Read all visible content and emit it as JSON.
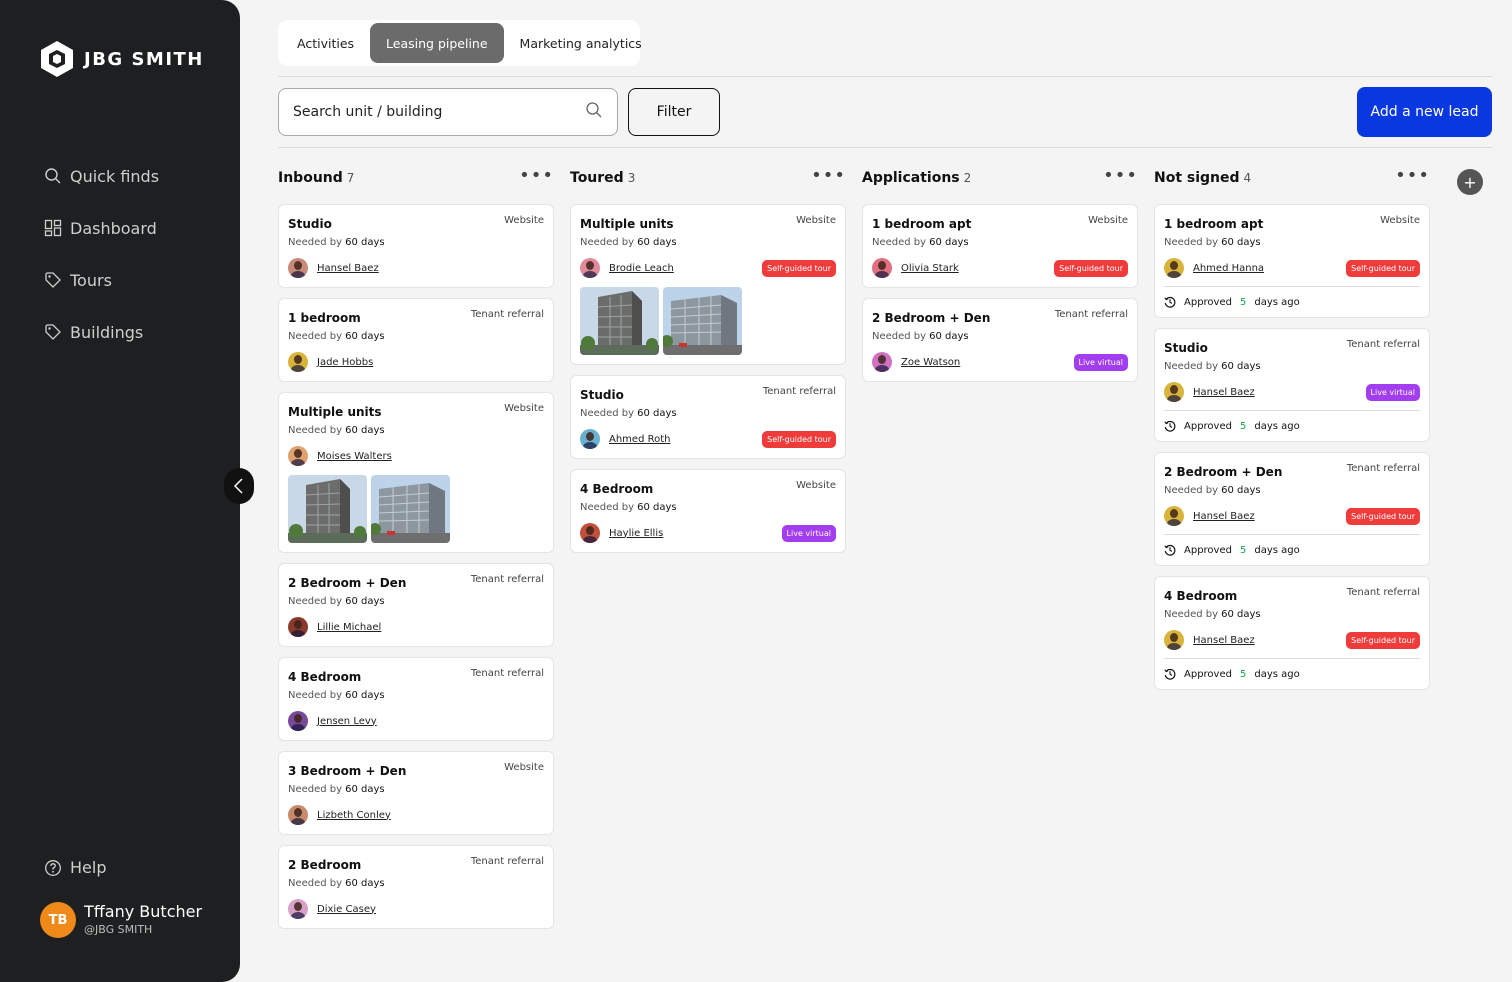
{
  "brand": {
    "name": "JBG SMITH"
  },
  "sidebar": {
    "nav": [
      {
        "label": "Quick finds",
        "icon": "search-icon"
      },
      {
        "label": "Dashboard",
        "icon": "dashboard-icon"
      },
      {
        "label": "Tours",
        "icon": "tag-icon"
      },
      {
        "label": "Buildings",
        "icon": "tag-icon"
      }
    ],
    "help": "Help",
    "user": {
      "initials": "TB",
      "name": "Tffany Butcher",
      "handle": "@JBG SMITH"
    }
  },
  "tabs": [
    {
      "label": "Activities",
      "active": false
    },
    {
      "label": "Leasing pipeline",
      "active": true
    },
    {
      "label": "Marketing analytics",
      "active": false
    }
  ],
  "toolbar": {
    "search_placeholder": "Search unit / building",
    "filter_label": "Filter",
    "add_label": "Add a new lead"
  },
  "colors": {
    "accent": "#0938e0",
    "tour_badge": "#f03b3b",
    "virtual_badge": "#a23ef0",
    "approved_count": "#1aa34a"
  },
  "columns": [
    {
      "title": "Inbound",
      "count": "7",
      "cards": [
        {
          "title": "Studio",
          "source": "Website",
          "needed_label": "Needed by",
          "needed_value": "60 days",
          "person": "Hansel Baez",
          "avatar": "#c98a7a"
        },
        {
          "title": "1 bedroom",
          "source": "Tenant referral",
          "needed_label": "Needed by",
          "needed_value": "60 days",
          "person": "Jade Hobbs",
          "avatar": "#d9b43a"
        },
        {
          "title": "Multiple units",
          "source": "Website",
          "needed_label": "Needed by",
          "needed_value": "60 days",
          "person": "Moises Walters",
          "avatar": "#e0a070",
          "images": true
        },
        {
          "title": "2 Bedroom + Den",
          "source": "Tenant referral",
          "needed_label": "Needed by",
          "needed_value": "60 days",
          "person": "Lillie Michael",
          "avatar": "#8a3a2a"
        },
        {
          "title": "4 Bedroom",
          "source": "Tenant referral",
          "needed_label": "Needed by",
          "needed_value": "60 days",
          "person": "Jensen Levy",
          "avatar": "#7a4a9a"
        },
        {
          "title": "3 Bedroom + Den",
          "source": "Website",
          "needed_label": "Needed by",
          "needed_value": "60 days",
          "person": "Lizbeth Conley",
          "avatar": "#c88a6a"
        },
        {
          "title": "2 Bedroom",
          "source": "Tenant referral",
          "needed_label": "Needed by",
          "needed_value": "60 days",
          "person": "Dixie Casey",
          "avatar": "#d8a0c8"
        }
      ]
    },
    {
      "title": "Toured",
      "count": "3",
      "cards": [
        {
          "title": "Multiple units",
          "source": "Website",
          "needed_label": "Needed by",
          "needed_value": "60 days",
          "person": "Brodie Leach",
          "avatar": "#e08a9a",
          "badge": "Self-guided tour",
          "badge_type": "red",
          "images": true
        },
        {
          "title": "Studio",
          "source": "Tenant referral",
          "needed_label": "Needed by",
          "needed_value": "60 days",
          "person": "Ahmed Roth",
          "avatar": "#6ab0d0",
          "badge": "Self-guided tour",
          "badge_type": "red"
        },
        {
          "title": "4 Bedroom",
          "source": "Website",
          "needed_label": "Needed by",
          "needed_value": "60 days",
          "person": "Haylie Ellis",
          "avatar": "#c0503a",
          "badge": "Live virtual",
          "badge_type": "purple"
        }
      ]
    },
    {
      "title": "Applications",
      "count": "2",
      "cards": [
        {
          "title": "1 bedroom apt",
          "source": "Website",
          "needed_label": "Needed by",
          "needed_value": "60 days",
          "person": "Olivia Stark",
          "avatar": "#e07080",
          "badge": "Self-guided tour",
          "badge_type": "red"
        },
        {
          "title": "2 Bedroom + Den",
          "source": "Tenant referral",
          "needed_label": "Needed by",
          "needed_value": "60 days",
          "person": "Zoe Watson",
          "avatar": "#d070c0",
          "badge": "Live virtual",
          "badge_type": "purple"
        }
      ]
    },
    {
      "title": "Not signed",
      "count": "4",
      "cards": [
        {
          "title": "1 bedroom apt",
          "source": "Website",
          "needed_label": "Needed by",
          "needed_value": "60 days",
          "person": "Ahmed Hanna",
          "avatar": "#d9b43a",
          "badge": "Self-guided tour",
          "badge_type": "red",
          "approved": {
            "label": "Approved",
            "days": "5",
            "suffix": "days ago"
          }
        },
        {
          "title": "Studio",
          "source": "Tenant referral",
          "needed_label": "Needed by",
          "needed_value": "60 days",
          "person": "Hansel Baez",
          "avatar": "#d9b43a",
          "badge": "Live virtual",
          "badge_type": "purple",
          "approved": {
            "label": "Approved",
            "days": "5",
            "suffix": "days ago"
          }
        },
        {
          "title": "2 Bedroom + Den",
          "source": "Tenant referral",
          "needed_label": "Needed by",
          "needed_value": "60 days",
          "person": "Hansel Baez",
          "avatar": "#d9b43a",
          "badge": "Self-guided tour",
          "badge_type": "red",
          "approved": {
            "label": "Approved",
            "days": "5",
            "suffix": "days ago"
          }
        },
        {
          "title": "4 Bedroom",
          "source": "Tenant referral",
          "needed_label": "Needed by",
          "needed_value": "60 days",
          "person": "Hansel Baez",
          "avatar": "#d9b43a",
          "badge": "Self-guided tour",
          "badge_type": "red",
          "approved": {
            "label": "Approved",
            "days": "5",
            "suffix": "days ago"
          }
        }
      ]
    }
  ]
}
